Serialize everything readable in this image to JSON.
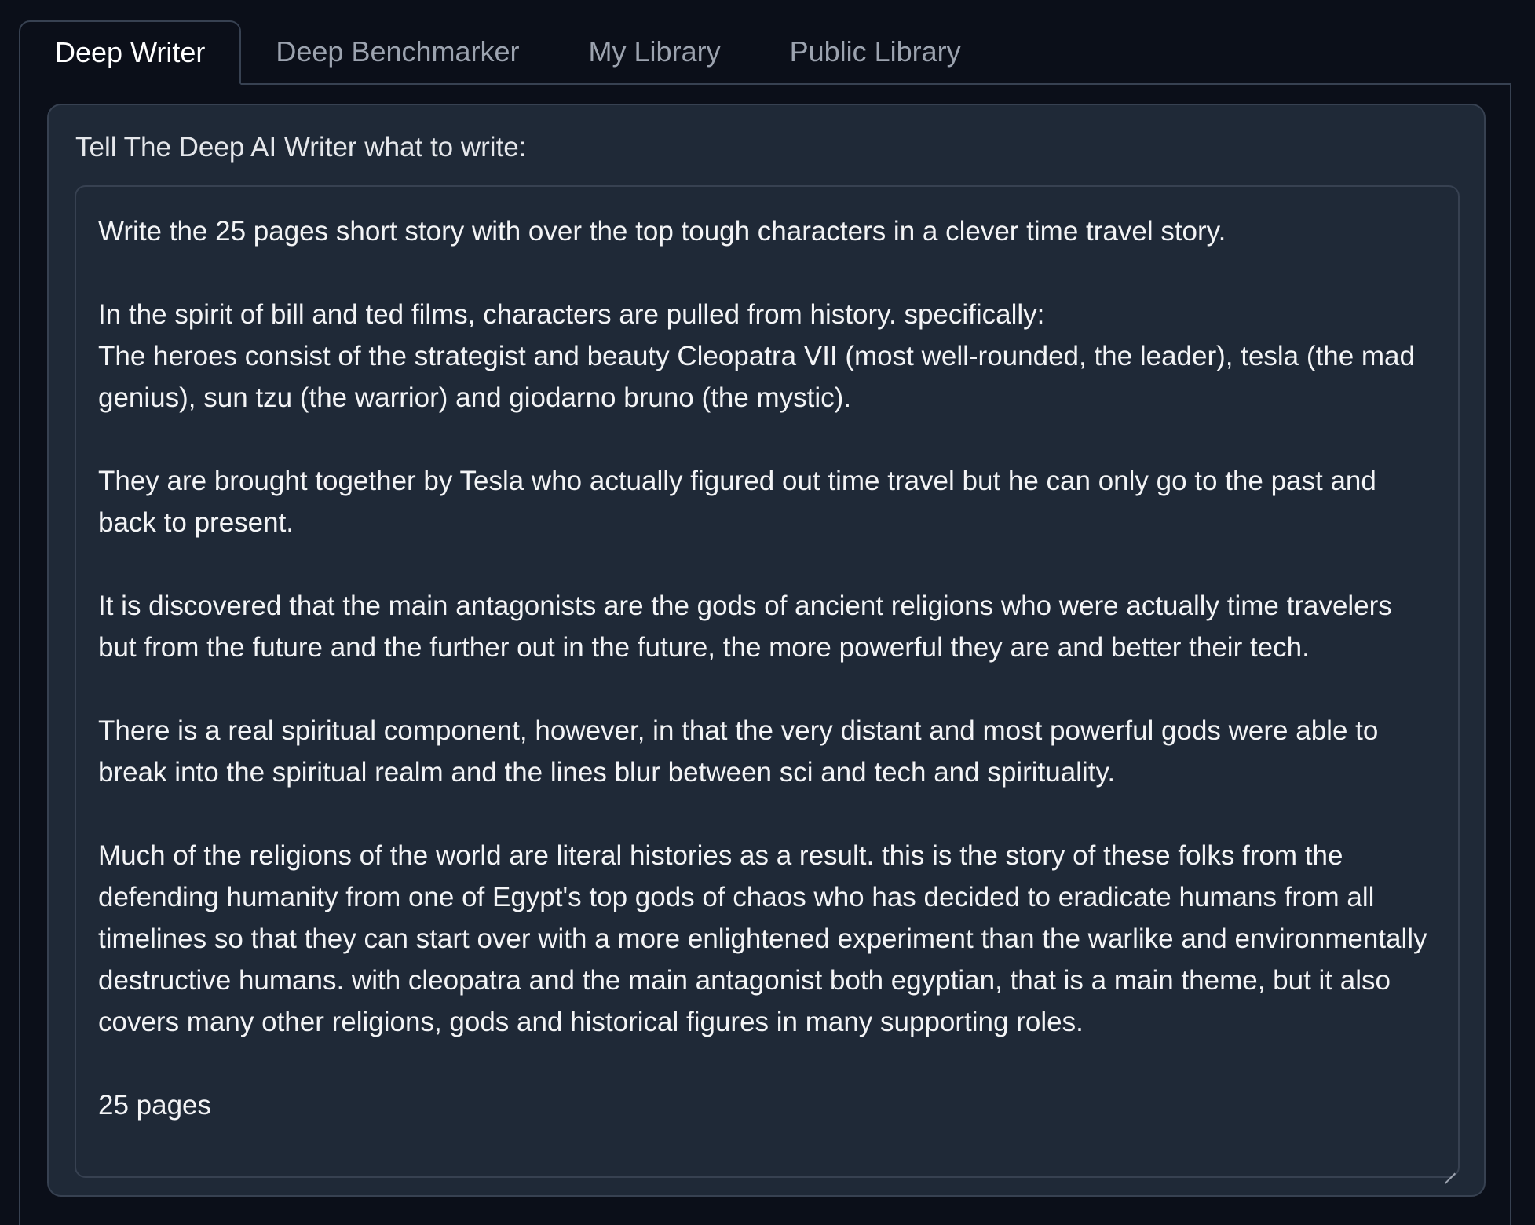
{
  "tabs": [
    {
      "label": "Deep Writer",
      "active": true
    },
    {
      "label": "Deep Benchmarker",
      "active": false
    },
    {
      "label": "My Library",
      "active": false
    },
    {
      "label": "Public Library",
      "active": false
    }
  ],
  "writer": {
    "prompt_label": "Tell The Deep AI Writer what to write:",
    "prompt_value": "Write the 25 pages short story with over the top tough characters in a clever time travel story.\n\nIn the spirit of bill and ted films, characters are pulled from history. specifically:\nThe heroes consist of the strategist and beauty Cleopatra VII (most well-rounded, the leader), tesla (the mad genius), sun tzu (the warrior) and giodarno bruno (the mystic).\n\nThey are brought together by Tesla who actually figured out time travel but he can only go to the past and back to present.\n\nIt is discovered that the main antagonists are the gods of ancient religions who were actually time travelers but from the future and the further out in the future, the more powerful they are and better their tech.\n\nThere is a real spiritual component, however, in that the very distant and most powerful gods were able to break into the spiritual realm and the lines blur between sci and tech and spirituality.\n\nMuch of the religions of the world are literal histories as a result. this is the story of these folks from the defending humanity from one of Egypt's top gods of chaos who has decided to eradicate humans from all timelines so that they can start over with a more enlightened experiment than the warlike and environmentally destructive humans. with cleopatra and the main antagonist both egyptian, that is a main theme, but it also covers many other religions, gods and historical figures in many supporting roles.\n\n25 pages"
  }
}
